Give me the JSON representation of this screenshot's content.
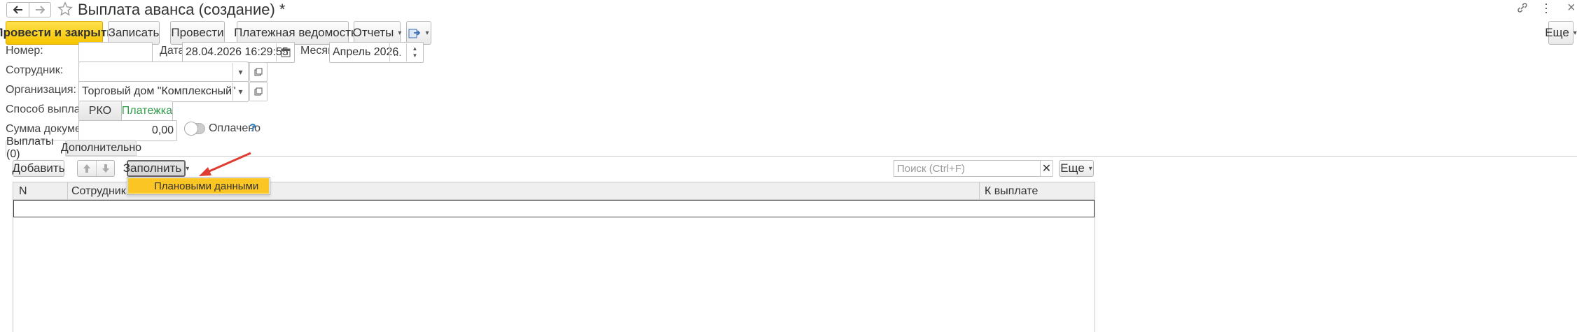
{
  "window": {
    "title": "Выплата аванса (создание) *"
  },
  "toolbar": {
    "post_close": "Провести и закрыть",
    "save": "Записать",
    "post": "Провести",
    "payment_sheet": "Платежная ведомость",
    "reports": "Отчеты",
    "more": "Еще"
  },
  "form": {
    "number_label": "Номер:",
    "number_value": "",
    "date_label": "Дата:",
    "date_value": "28.04.2026 16:29:55",
    "month_label": "Месяц:",
    "month_value": "Апрель 2026",
    "employee_label": "Сотрудник:",
    "employee_value": "",
    "org_label": "Организация:",
    "org_value": "Торговый дом \"Комплексный\"",
    "payment_method_label": "Способ выплаты:",
    "payment_method_options": [
      "РКО",
      "Платежка"
    ],
    "payment_method_selected": "Платежка",
    "sum_label": "Сумма документа:",
    "sum_value": "0,00",
    "paid_label": "Оплачено",
    "paid_help": "?"
  },
  "tabs": [
    {
      "label": "Выплаты (0)",
      "active": true
    },
    {
      "label": "Дополнительно",
      "active": false
    }
  ],
  "table_toolbar": {
    "add": "Добавить",
    "fill": "Заполнить",
    "search_placeholder": "Поиск (Ctrl+F)",
    "more": "Еще"
  },
  "fill_menu": {
    "items": [
      "Плановыми данными"
    ]
  },
  "table": {
    "columns": [
      "N",
      "Сотрудник",
      "К выплате"
    ],
    "rows": []
  },
  "colors": {
    "primary": "#f5c400",
    "menu_highlight": "#fbc523",
    "arrow": "#e03c31",
    "active_option": "#2f9c4a"
  },
  "icons": [
    "back-arrow-icon",
    "forward-arrow-icon",
    "star-icon",
    "link-icon",
    "kebab-icon",
    "close-icon",
    "printer-icon",
    "export-icon",
    "calendar-icon",
    "dropdown-icon",
    "open-icon",
    "up-arrow-icon",
    "down-arrow-icon",
    "clear-icon",
    "toggle-icon"
  ]
}
